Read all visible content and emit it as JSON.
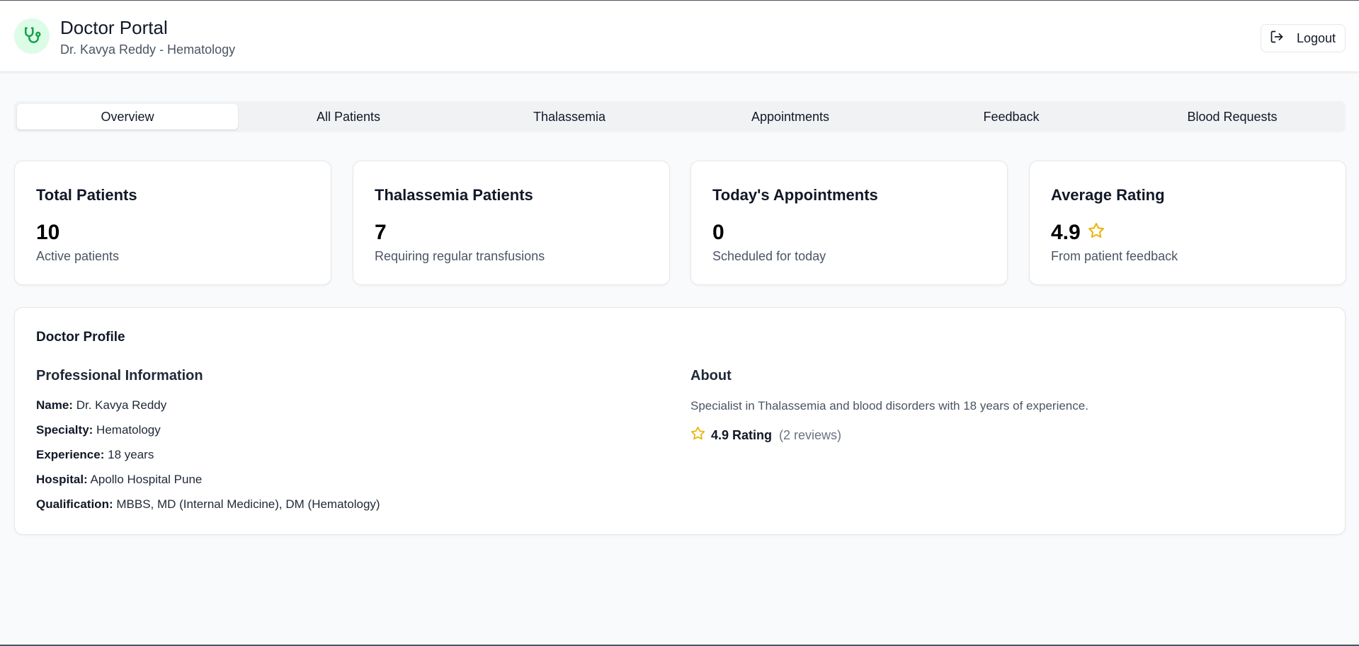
{
  "header": {
    "title": "Doctor Portal",
    "subtitle": "Dr. Kavya Reddy - Hematology",
    "logout_label": "Logout",
    "brand_icon": "stethoscope-icon",
    "brand_color": "#16a34a"
  },
  "tabs": [
    {
      "label": "Overview",
      "active": true
    },
    {
      "label": "All Patients",
      "active": false
    },
    {
      "label": "Thalassemia",
      "active": false
    },
    {
      "label": "Appointments",
      "active": false
    },
    {
      "label": "Feedback",
      "active": false
    },
    {
      "label": "Blood Requests",
      "active": false
    }
  ],
  "stats": [
    {
      "title": "Total Patients",
      "value": "10",
      "caption": "Active patients"
    },
    {
      "title": "Thalassemia Patients",
      "value": "7",
      "caption": "Requiring regular transfusions"
    },
    {
      "title": "Today's Appointments",
      "value": "0",
      "caption": "Scheduled for today"
    },
    {
      "title": "Average Rating",
      "value": "4.9",
      "caption": "From patient feedback",
      "icon": "star-icon"
    }
  ],
  "profile": {
    "title": "Doctor Profile",
    "professional": {
      "title": "Professional Information",
      "rows": [
        {
          "key": "Name:",
          "value": "Dr. Kavya Reddy"
        },
        {
          "key": "Specialty:",
          "value": "Hematology"
        },
        {
          "key": "Experience:",
          "value": "18 years"
        },
        {
          "key": "Hospital:",
          "value": "Apollo Hospital Pune"
        },
        {
          "key": "Qualification:",
          "value": "MBBS, MD (Internal Medicine), DM (Hematology)"
        }
      ]
    },
    "about": {
      "title": "About",
      "text": "Specialist in Thalassemia and blood disorders with 18 years of experience.",
      "rating_label": "4.9 Rating",
      "reviews_label": "(2 reviews)"
    }
  },
  "colors": {
    "star": "#eab308",
    "accent_green": "#16a34a"
  }
}
